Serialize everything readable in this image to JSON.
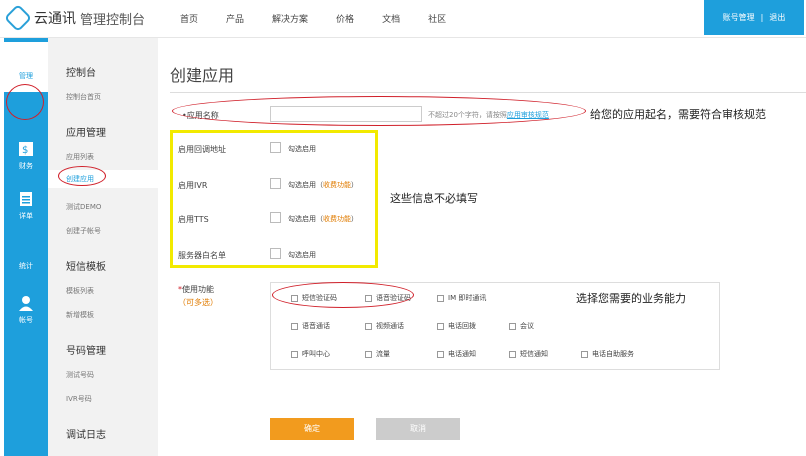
{
  "header": {
    "logo_name": "云通讯",
    "logo_sub": "管理控制台",
    "nav": [
      "首页",
      "产品",
      "解决方案",
      "价格",
      "文档",
      "社区"
    ],
    "account": "账号管理",
    "divider": "|",
    "logout": "退出"
  },
  "iconbar": {
    "items": [
      {
        "label": "管理",
        "icon": "grid-icon",
        "active": true
      },
      {
        "label": "财务",
        "icon": "finance-icon"
      },
      {
        "label": "详单",
        "icon": "detail-icon"
      },
      {
        "label": "统计",
        "icon": "stats-icon"
      },
      {
        "label": "帐号",
        "icon": "user-icon"
      }
    ]
  },
  "sidebar": {
    "sections": [
      {
        "heading": "控制台",
        "items": [
          "控制台首页"
        ]
      },
      {
        "heading": "应用管理",
        "items": [
          "应用列表",
          "创建应用",
          "测试DEMO",
          "创建子帐号"
        ]
      },
      {
        "heading": "短信模板",
        "items": [
          "模板列表",
          "新增模板"
        ]
      },
      {
        "heading": "号码管理",
        "items": [
          "测试号码",
          "IVR号码"
        ]
      },
      {
        "heading": "调试日志",
        "items": []
      }
    ]
  },
  "form": {
    "page_title": "创建应用",
    "app_name_label": "应用名称",
    "app_name_value": "",
    "app_name_hint_prefix": "不超过20个字符，请按照",
    "app_name_hint_link": "应用审核规范",
    "callback_label": "启用回调地址",
    "callback_opt": "勾选启用",
    "ivr_label": "启用IVR",
    "ivr_opt": "勾选启用（",
    "ivr_tag": "收费功能",
    "ivr_close": "）",
    "tts_label": "启用TTS",
    "tts_opt": "勾选启用（",
    "tts_tag": "收费功能",
    "tts_close": "）",
    "whitelist_label": "服务器白名单",
    "whitelist_opt": "勾选启用",
    "func_star": "*",
    "func_label": "使用功能",
    "func_sub": "（可多选）",
    "func_rows": [
      [
        "短信验证码",
        "语音验证码",
        "IM 即时通讯"
      ],
      [
        "语音通话",
        "视频通话",
        "电话回拨",
        "会议"
      ],
      [
        "呼叫中心",
        "流量",
        "电话通知",
        "短信通知",
        "电话自助服务"
      ]
    ],
    "ok_label": "确定",
    "cancel_label": "取消"
  },
  "annotations": {
    "name_note": "给您的应用起名，需要符合审核规范",
    "optional_note": "这些信息不必填写",
    "func_note": "选择您需要的业务能力"
  },
  "colors": {
    "brand": "#1e9fdc",
    "ok_button": "#f29b1e",
    "annotation_red": "#d0202a",
    "annotation_yellow": "#f2ea00"
  }
}
